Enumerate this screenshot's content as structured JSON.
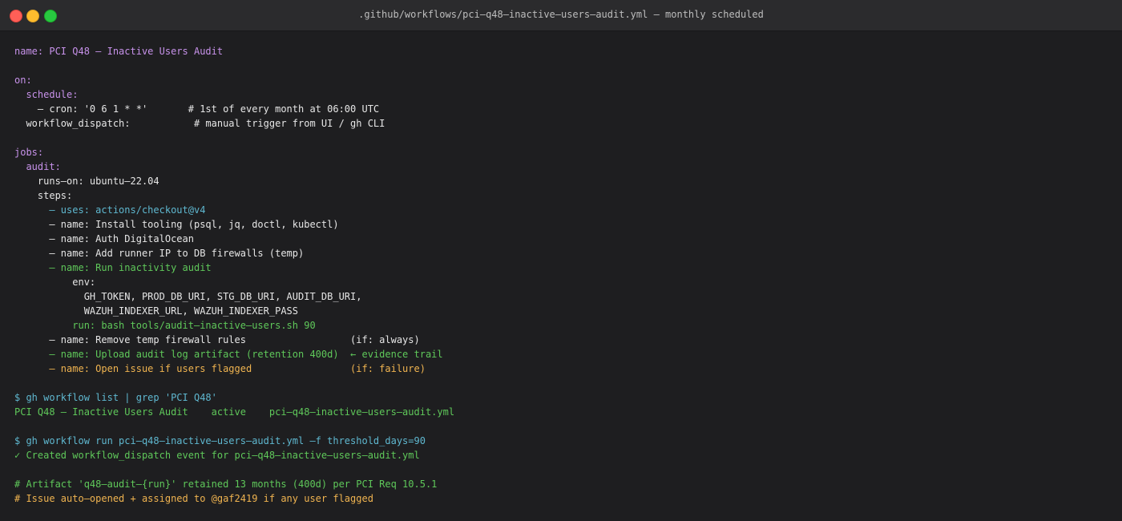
{
  "window": {
    "title": ".github/workflows/pci–q48–inactive–users–audit.yml — monthly scheduled"
  },
  "colors": {
    "background": "#1e1e20",
    "titlebar": "#2b2b2d",
    "white": "#e6e6e6",
    "purple": "#c792ea",
    "cyan": "#5fb8d0",
    "green": "#5fc85a",
    "orange": "#f0b450"
  },
  "lines": [
    {
      "segments": [
        {
          "text": "name: PCI Q48 — Inactive Users Audit",
          "color": "purple"
        }
      ]
    },
    {
      "segments": []
    },
    {
      "segments": [
        {
          "text": "on:",
          "color": "purple"
        }
      ]
    },
    {
      "segments": [
        {
          "text": "  schedule:",
          "color": "purple"
        }
      ]
    },
    {
      "segments": [
        {
          "text": "    – cron: '0 6 1 * *'       # 1st of every month at 06:00 UTC",
          "color": "white"
        }
      ]
    },
    {
      "segments": [
        {
          "text": "  workflow_dispatch:           # manual trigger from UI / gh CLI",
          "color": "white"
        }
      ]
    },
    {
      "segments": []
    },
    {
      "segments": [
        {
          "text": "jobs:",
          "color": "purple"
        }
      ]
    },
    {
      "segments": [
        {
          "text": "  audit:",
          "color": "purple"
        }
      ]
    },
    {
      "segments": [
        {
          "text": "    runs–on: ubuntu–22.04",
          "color": "white"
        }
      ]
    },
    {
      "segments": [
        {
          "text": "    steps:",
          "color": "white"
        }
      ]
    },
    {
      "segments": [
        {
          "text": "      – uses: actions/checkout@v4",
          "color": "cyan"
        }
      ]
    },
    {
      "segments": [
        {
          "text": "      – name: Install tooling (psql, jq, doctl, kubectl)",
          "color": "white"
        }
      ]
    },
    {
      "segments": [
        {
          "text": "      – name: Auth DigitalOcean",
          "color": "white"
        }
      ]
    },
    {
      "segments": [
        {
          "text": "      – name: Add runner IP to DB firewalls (temp)",
          "color": "white"
        }
      ]
    },
    {
      "segments": [
        {
          "text": "      – name: Run inactivity audit",
          "color": "green"
        }
      ]
    },
    {
      "segments": [
        {
          "text": "          env:",
          "color": "white"
        }
      ]
    },
    {
      "segments": [
        {
          "text": "            GH_TOKEN, PROD_DB_URI, STG_DB_URI, AUDIT_DB_URI,",
          "color": "white"
        }
      ]
    },
    {
      "segments": [
        {
          "text": "            WAZUH_INDEXER_URL, WAZUH_INDEXER_PASS",
          "color": "white"
        }
      ]
    },
    {
      "segments": [
        {
          "text": "          run: bash tools/audit–inactive–users.sh 90",
          "color": "green"
        }
      ]
    },
    {
      "segments": [
        {
          "text": "      – name: Remove temp firewall rules                  (if: always)",
          "color": "white"
        }
      ]
    },
    {
      "segments": [
        {
          "text": "      – name: Upload audit log artifact (retention 400d)  ← evidence trail",
          "color": "green"
        }
      ]
    },
    {
      "segments": [
        {
          "text": "      – name: Open issue if users flagged                 (if: failure)",
          "color": "orange"
        }
      ]
    },
    {
      "segments": []
    },
    {
      "segments": [
        {
          "text": "$ gh workflow list | grep 'PCI Q48'",
          "color": "cyan"
        }
      ]
    },
    {
      "segments": [
        {
          "text": "PCI Q48 — Inactive Users Audit    active    pci–q48–inactive–users–audit.yml",
          "color": "green"
        }
      ]
    },
    {
      "segments": []
    },
    {
      "segments": [
        {
          "text": "$ gh workflow run pci–q48–inactive–users–audit.yml –f threshold_days=90",
          "color": "cyan"
        }
      ]
    },
    {
      "segments": [
        {
          "text": "✓ Created workflow_dispatch event for pci–q48–inactive–users–audit.yml",
          "color": "green"
        }
      ]
    },
    {
      "segments": []
    },
    {
      "segments": [
        {
          "text": "# Artifact 'q48–audit–{run}' retained 13 months (400d) per PCI Req 10.5.1",
          "color": "green"
        }
      ]
    },
    {
      "segments": [
        {
          "text": "# Issue auto–opened + assigned to @gaf2419 if any user flagged",
          "color": "orange"
        }
      ]
    }
  ]
}
